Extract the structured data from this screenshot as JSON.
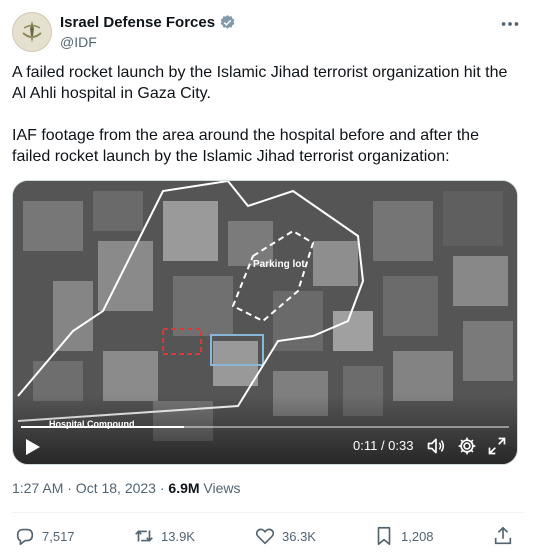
{
  "author": {
    "name": "Israel Defense Forces",
    "handle": "@IDF"
  },
  "tweet": {
    "paragraph1": "A failed rocket launch by the Islamic Jihad terrorist organization hit the Al Ahli hospital in Gaza City.",
    "paragraph2": "IAF footage from the area around the hospital before and after the failed rocket launch by the Islamic Jihad terrorist organization:"
  },
  "video": {
    "label_parking": "Parking lot",
    "label_hospital": "Hospital Compound",
    "time": "0:11 / 0:33",
    "progress": 0.333
  },
  "meta": {
    "timestamp": "1:27 AM · Oct 18, 2023 · ",
    "views_count": "6.9M",
    "views_label": " Views"
  },
  "actions": {
    "replies": "7,517",
    "reposts": "13.9K",
    "likes": "36.3K",
    "bookmarks": "1,208"
  },
  "colors": {
    "verified": "#829aab",
    "text_secondary": "#536471"
  }
}
